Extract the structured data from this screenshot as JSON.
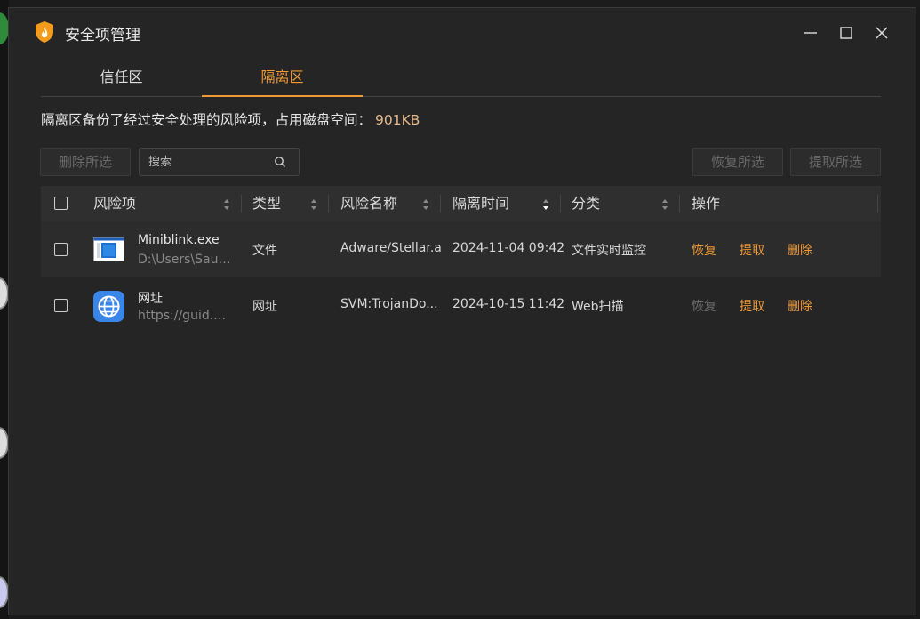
{
  "window": {
    "title": "安全项管理"
  },
  "tabs": [
    {
      "label": "信任区",
      "active": false
    },
    {
      "label": "隔离区",
      "active": true
    }
  ],
  "info": {
    "text": "隔离区备份了经过安全处理的风险项，占用磁盘空间：",
    "size": "901KB"
  },
  "toolbar": {
    "delete_label": "删除所选",
    "search_placeholder": "搜索",
    "restore_label": "恢复所选",
    "extract_label": "提取所选"
  },
  "table": {
    "headers": [
      "风险项",
      "类型",
      "风险名称",
      "隔离时间",
      "分类",
      "操作"
    ],
    "rows": [
      {
        "name": "Miniblink.exe",
        "path": "D:\\Users\\Saul...",
        "type": "文件",
        "risk_name": "Adware/Stellar.a",
        "time": "2024-11-04 09:42",
        "category": "文件实时监控",
        "restore": "恢复",
        "extract": "提取",
        "delete": "删除",
        "icon": "exe-file-icon"
      },
      {
        "name": "网址",
        "path": "https://guid.c...",
        "type": "网址",
        "risk_name": "SVM:TrojanDo...",
        "time": "2024-10-15 11:42",
        "category": "Web扫描",
        "restore": "恢复",
        "extract": "提取",
        "delete": "删除",
        "icon": "globe-icon"
      }
    ]
  },
  "colors": {
    "accent": "#f09a35",
    "background": "#252525",
    "header_bg": "#2f2f2f"
  }
}
